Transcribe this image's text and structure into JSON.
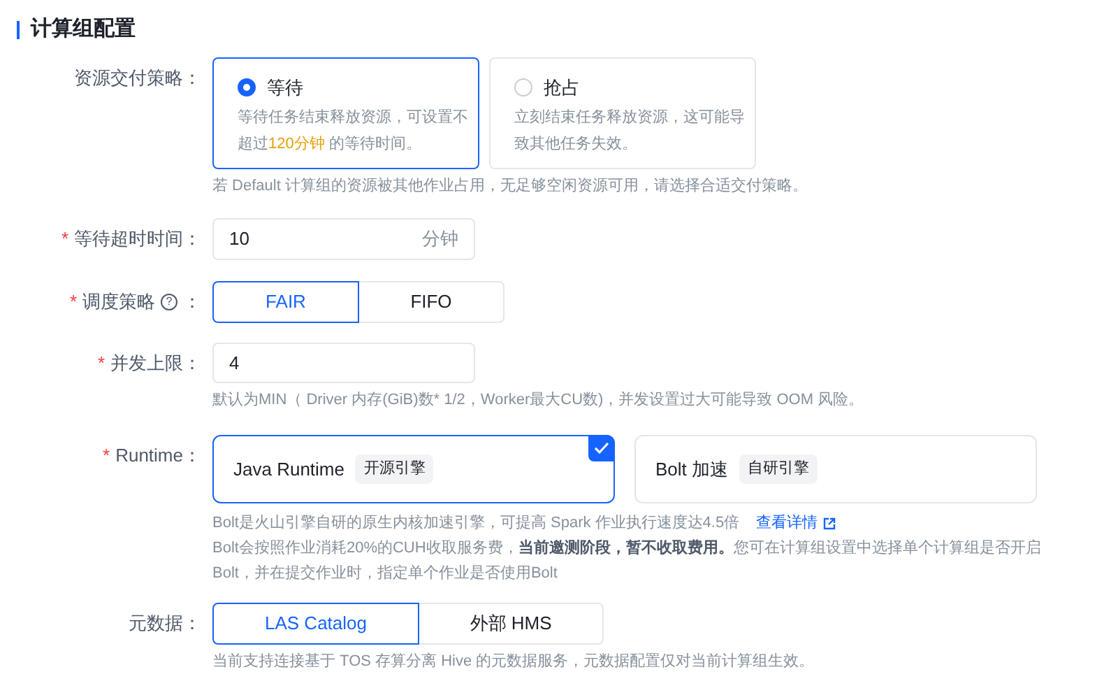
{
  "section_title": "计算组配置",
  "delivery": {
    "label": "资源交付策略：",
    "options": [
      {
        "title": "等待",
        "desc": "等待任务结束释放资源，可设置不超过**120分钟** 的等待时间。",
        "selected": true
      },
      {
        "title": "抢占",
        "desc": "立刻结束任务释放资源，这可能导致其他任务失效。",
        "selected": false
      }
    ],
    "hint": "若 Default 计算组的资源被其他作业占用，无足够空闲资源可用，请选择合适交付策略。"
  },
  "timeout": {
    "label": "等待超时时间：",
    "required_mark": "*",
    "value": "10",
    "suffix": "分钟"
  },
  "schedule": {
    "label": "调度策略",
    "required_mark": "*",
    "help_icon": "?",
    "colon": "：",
    "options": [
      {
        "label": "FAIR",
        "selected": true
      },
      {
        "label": "FIFO",
        "selected": false
      }
    ]
  },
  "concurrency": {
    "label": "并发上限：",
    "required_mark": "*",
    "value": "4",
    "hint": "默认为MIN（ Driver 内存(GiB)数* 1/2，Worker最大CU数)，并发设置过大可能导致 OOM 风险。"
  },
  "runtime": {
    "label": "Runtime：",
    "required_mark": "*",
    "options": [
      {
        "title": "Java Runtime",
        "tag": "开源引擎",
        "selected": true
      },
      {
        "title": "Bolt 加速",
        "tag": "自研引擎",
        "selected": false
      }
    ],
    "hint": "Bolt是火山引擎自研的原生内核加速引擎，可提高 Spark 作业执行速度达4.5倍",
    "link": "查看详情",
    "note": "Bolt会按照作业消耗20%的CUH收取服务费，**当前邀测阶段，暂不收取费用。**您可在计算组设置中选择单个计算组是否开启Bolt，并在提交作业时，指定单个作业是否使用Bolt"
  },
  "metadata": {
    "label": "元数据：",
    "options": [
      {
        "label": "LAS Catalog",
        "selected": true
      },
      {
        "label": "外部 HMS",
        "selected": false
      }
    ],
    "hint": "当前支持连接基于 TOS 存算分离 Hive 的元数据服务，元数据配置仅对当前计算组生效。"
  }
}
